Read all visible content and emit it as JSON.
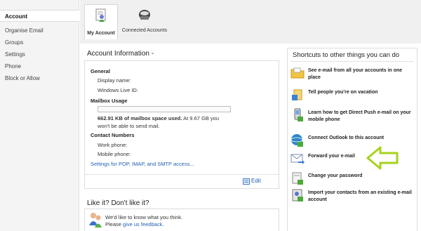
{
  "sidebar": {
    "items": [
      {
        "label": "Account",
        "active": true
      },
      {
        "label": "Organise Email",
        "active": false
      },
      {
        "label": "Groups",
        "active": false
      },
      {
        "label": "Settings",
        "active": false
      },
      {
        "label": "Phone",
        "active": false
      },
      {
        "label": "Block or Allow",
        "active": false
      }
    ]
  },
  "tabs": [
    {
      "label": "My Account",
      "icon": "my-account-icon",
      "active": true
    },
    {
      "label": "Connected Accounts",
      "icon": "connected-accounts-icon",
      "active": false
    }
  ],
  "account_info": {
    "title": "Account Information -",
    "general": {
      "heading": "General",
      "display_name_label": "Display name:",
      "windows_live_id_label": "Windows Live ID:"
    },
    "mailbox": {
      "heading": "Mailbox Usage",
      "usage_strong": "662.91 KB of mailbox space used.",
      "usage_rest": " At 9.67 GB you won't be able to send mail."
    },
    "contact": {
      "heading": "Contact Numbers",
      "work_label": "Work phone:",
      "mobile_label": "Mobile phone:"
    },
    "pop_link": "Settings for POP, IMAP, and SMTP access...",
    "edit_label": "Edit"
  },
  "feedback": {
    "title": "Like it? Don't like it?",
    "line1": "We'd like to know what you think.",
    "line2_prefix": "Please ",
    "line2_link": "give us feedback",
    "line2_suffix": "."
  },
  "shortcuts": {
    "title": "Shortcuts to other things you can do",
    "items": [
      {
        "label": "See e-mail from all your accounts in one place",
        "icon": "folder-icon"
      },
      {
        "label": "Tell people you're on vacation",
        "icon": "vacation-icon"
      },
      {
        "label": "Learn how to get Direct Push e-mail on your mobile phone",
        "icon": "mobile-phone-icon"
      },
      {
        "label": "Connect Outlook to this account",
        "icon": "outlook-icon"
      },
      {
        "label": "Forward your e-mail",
        "icon": "forward-mail-icon"
      },
      {
        "label": "Change your password",
        "icon": "password-icon"
      },
      {
        "label": "Import your contacts from an existing e-mail account",
        "icon": "import-contacts-icon"
      }
    ]
  },
  "colors": {
    "link": "#1f5fb3",
    "highlight_arrow": "#a6d21e",
    "sidebar_bg": "#f4f4f4"
  }
}
